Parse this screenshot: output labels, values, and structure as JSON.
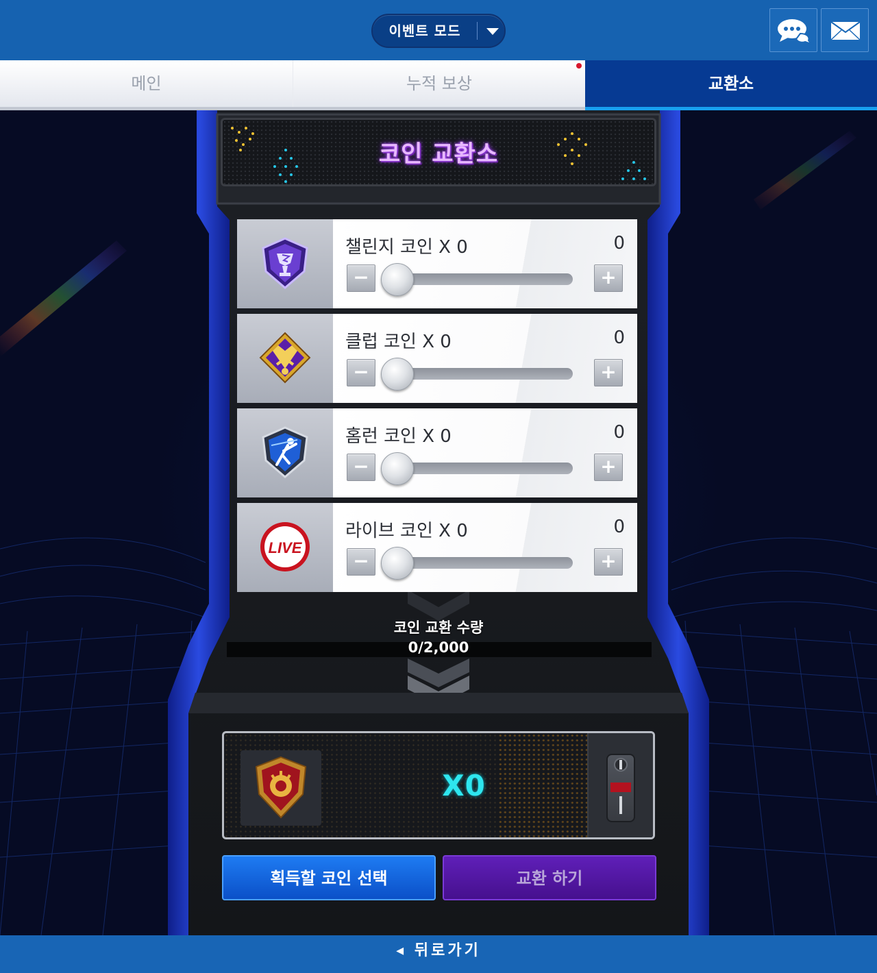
{
  "header": {
    "mode_label": "이벤트 모드",
    "chat_icon": "chat-icon",
    "mail_icon": "mail-icon"
  },
  "tabs": [
    {
      "label": "메인",
      "state": "inactive"
    },
    {
      "label": "누적 보상",
      "state": "inactive",
      "badge": "new"
    },
    {
      "label": "교환소",
      "state": "active"
    }
  ],
  "exchange": {
    "title": "코인 교환소",
    "coins": [
      {
        "name": "챌린지 코인 X 0",
        "count": "0",
        "slider_value": 0,
        "icon": "challenge-coin-icon"
      },
      {
        "name": "클럽 코인 X 0",
        "count": "0",
        "slider_value": 0,
        "icon": "club-coin-icon"
      },
      {
        "name": "홈런 코인 X 0",
        "count": "0",
        "slider_value": 0,
        "icon": "homerun-coin-icon"
      },
      {
        "name": "라이브 코인 X 0",
        "count": "0",
        "slider_value": 0,
        "icon": "live-coin-icon"
      }
    ],
    "minus_label": "−",
    "plus_label": "+",
    "quantity_label": "코인 교환 수량",
    "quantity_value": "0/2,000",
    "result_qty": "X0",
    "result_icon": "target-coin-icon",
    "live_badge_text": "LIVE",
    "select_button": "획득할 코인 선택",
    "exchange_button": "교환 하기"
  },
  "footer": {
    "back_label": "◂ 뒤로가기"
  },
  "colors": {
    "topbar": "#1662b0",
    "active_tab": "#063a93",
    "accent_cyan": "#2ee6ef",
    "select_button": "#1e7bf2",
    "exchange_button": "#5f1fb8"
  }
}
